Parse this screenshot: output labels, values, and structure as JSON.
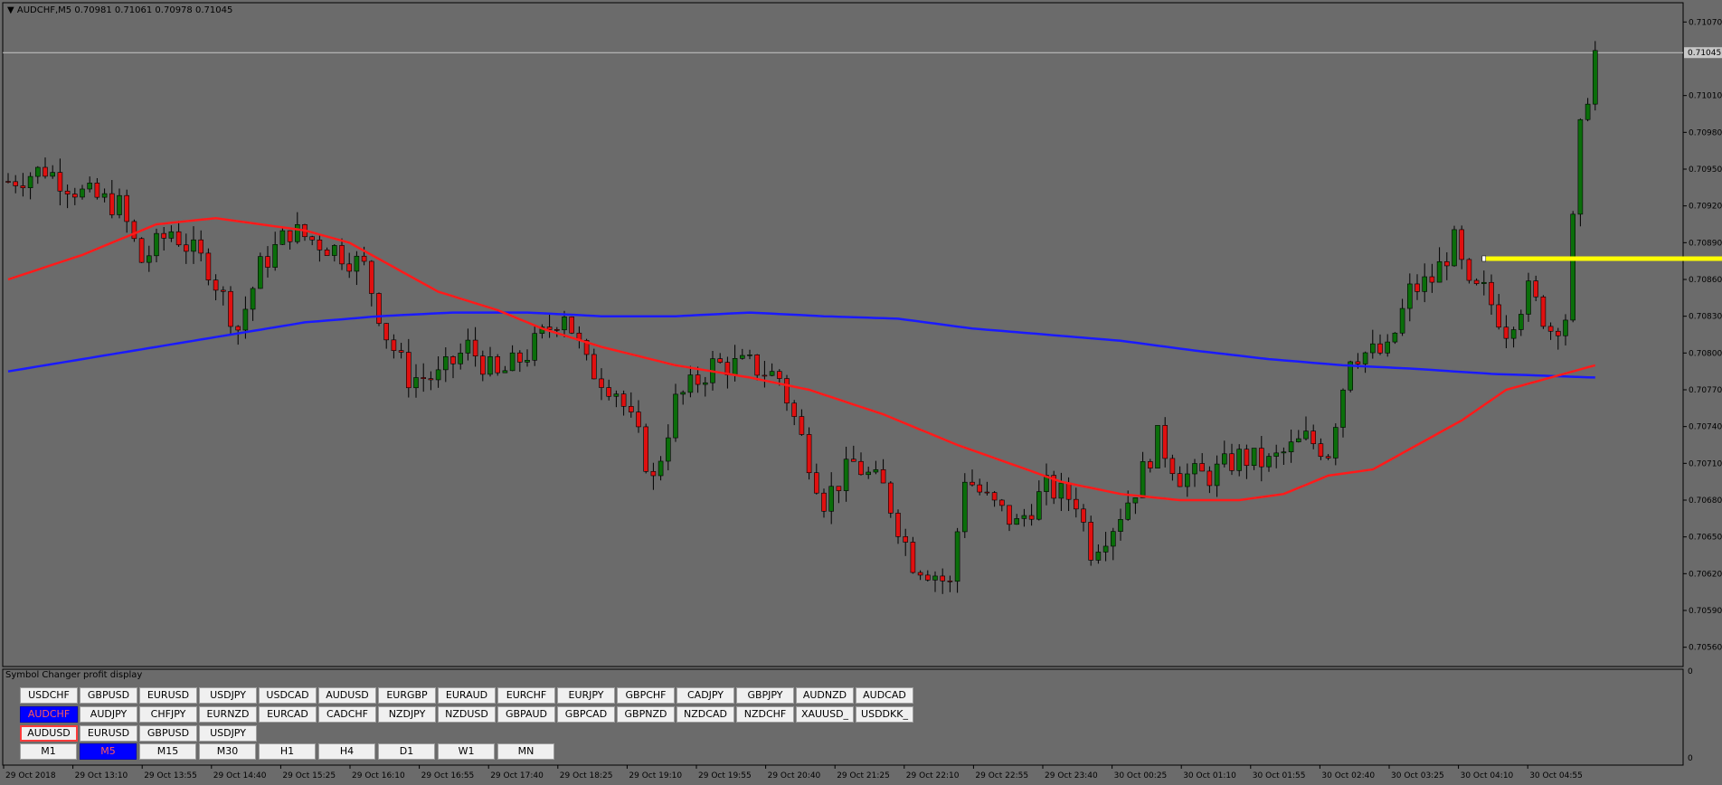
{
  "window": {
    "symbol_title": "AUDCHF,M5",
    "ohlc": "0.70981 0.71061 0.70978 0.71045"
  },
  "colors": {
    "background": "#6b6b6b",
    "bull": "#0a6e0a",
    "bear": "#e01010",
    "ma_fast": "#ff1a1a",
    "ma_slow": "#1a1aff",
    "level": "#ffff00",
    "price_line": "#c8c8c8"
  },
  "chart_data": {
    "type": "candlestick",
    "ylim": [
      0.70545,
      0.71085
    ],
    "x_count": 240,
    "y_ticks": [
      "0.71070",
      "0.71010",
      "0.70980",
      "0.70950",
      "0.70920",
      "0.70890",
      "0.70860",
      "0.70830",
      "0.70800",
      "0.70770",
      "0.70740",
      "0.70710",
      "0.70680",
      "0.70650",
      "0.70620",
      "0.70590",
      "0.70560"
    ],
    "current_price": "0.71045",
    "x_ticks": [
      "29 Oct 2018",
      "29 Oct 13:10",
      "29 Oct 13:55",
      "29 Oct 14:40",
      "29 Oct 15:25",
      "29 Oct 16:10",
      "29 Oct 16:55",
      "29 Oct 17:40",
      "29 Oct 18:25",
      "29 Oct 19:10",
      "29 Oct 19:55",
      "29 Oct 20:40",
      "29 Oct 21:25",
      "29 Oct 22:10",
      "29 Oct 22:55",
      "29 Oct 23:40",
      "30 Oct 00:25",
      "30 Oct 01:10",
      "30 Oct 01:55",
      "30 Oct 02:40",
      "30 Oct 03:25",
      "30 Oct 04:10",
      "30 Oct 04:55"
    ],
    "close_path": [
      [
        0,
        0.7094
      ],
      [
        5,
        0.7095
      ],
      [
        10,
        0.7093
      ],
      [
        15,
        0.7092
      ],
      [
        18,
        0.70875
      ],
      [
        22,
        0.709
      ],
      [
        27,
        0.7087
      ],
      [
        31,
        0.7082
      ],
      [
        34,
        0.7087
      ],
      [
        38,
        0.709
      ],
      [
        44,
        0.70885
      ],
      [
        48,
        0.7087
      ],
      [
        51,
        0.70815
      ],
      [
        54,
        0.7078
      ],
      [
        58,
        0.7078
      ],
      [
        62,
        0.70805
      ],
      [
        66,
        0.7078
      ],
      [
        70,
        0.708
      ],
      [
        75,
        0.70835
      ],
      [
        78,
        0.7079
      ],
      [
        82,
        0.7077
      ],
      [
        85,
        0.7073
      ],
      [
        87,
        0.70695
      ],
      [
        90,
        0.7076
      ],
      [
        95,
        0.7079
      ],
      [
        100,
        0.7079
      ],
      [
        104,
        0.7078
      ],
      [
        107,
        0.7073
      ],
      [
        110,
        0.7068
      ],
      [
        114,
        0.7071
      ],
      [
        118,
        0.7069
      ],
      [
        122,
        0.7063
      ],
      [
        125,
        0.7062
      ],
      [
        127,
        0.7061
      ],
      [
        129,
        0.707
      ],
      [
        132,
        0.7068
      ],
      [
        136,
        0.7066
      ],
      [
        140,
        0.7069
      ],
      [
        144,
        0.7068
      ],
      [
        146,
        0.7064
      ],
      [
        149,
        0.7066
      ],
      [
        152,
        0.7069
      ],
      [
        155,
        0.7073
      ],
      [
        158,
        0.707
      ],
      [
        162,
        0.707
      ],
      [
        166,
        0.70715
      ],
      [
        170,
        0.7071
      ],
      [
        175,
        0.7073
      ],
      [
        178,
        0.7072
      ],
      [
        181,
        0.708
      ],
      [
        186,
        0.708
      ],
      [
        189,
        0.7085
      ],
      [
        192,
        0.7086
      ],
      [
        195,
        0.7089
      ],
      [
        197,
        0.7085
      ],
      [
        199,
        0.7085
      ],
      [
        202,
        0.7082
      ],
      [
        205,
        0.7085
      ],
      [
        208,
        0.7082
      ],
      [
        210,
        0.7083
      ],
      [
        212,
        0.7098
      ],
      [
        214,
        0.71045
      ]
    ],
    "ma_fast": [
      [
        0,
        0.7086
      ],
      [
        10,
        0.7088
      ],
      [
        20,
        0.70905
      ],
      [
        28,
        0.7091
      ],
      [
        34,
        0.70905
      ],
      [
        40,
        0.709
      ],
      [
        46,
        0.7089
      ],
      [
        52,
        0.7087
      ],
      [
        58,
        0.7085
      ],
      [
        66,
        0.70835
      ],
      [
        72,
        0.7082
      ],
      [
        80,
        0.70805
      ],
      [
        90,
        0.7079
      ],
      [
        100,
        0.7078
      ],
      [
        108,
        0.7077
      ],
      [
        118,
        0.7075
      ],
      [
        128,
        0.70725
      ],
      [
        135,
        0.7071
      ],
      [
        142,
        0.70695
      ],
      [
        150,
        0.70685
      ],
      [
        158,
        0.7068
      ],
      [
        166,
        0.7068
      ],
      [
        172,
        0.70685
      ],
      [
        178,
        0.707
      ],
      [
        184,
        0.70705
      ],
      [
        190,
        0.70725
      ],
      [
        196,
        0.70745
      ],
      [
        202,
        0.7077
      ],
      [
        208,
        0.7078
      ],
      [
        214,
        0.7079
      ]
    ],
    "ma_slow": [
      [
        0,
        0.70785
      ],
      [
        10,
        0.70795
      ],
      [
        20,
        0.70805
      ],
      [
        30,
        0.70815
      ],
      [
        40,
        0.70825
      ],
      [
        50,
        0.7083
      ],
      [
        60,
        0.70833
      ],
      [
        70,
        0.70833
      ],
      [
        80,
        0.7083
      ],
      [
        90,
        0.7083
      ],
      [
        100,
        0.70833
      ],
      [
        110,
        0.7083
      ],
      [
        120,
        0.70828
      ],
      [
        130,
        0.7082
      ],
      [
        140,
        0.70815
      ],
      [
        150,
        0.7081
      ],
      [
        160,
        0.70802
      ],
      [
        170,
        0.70795
      ],
      [
        180,
        0.7079
      ],
      [
        190,
        0.70787
      ],
      [
        200,
        0.70783
      ],
      [
        214,
        0.7078
      ]
    ],
    "level_line": {
      "price": 0.70877,
      "x_start": 199,
      "x_end": 234
    }
  },
  "panel": {
    "title": "Symbol Changer profit display",
    "scale_top": "0",
    "scale_bottom": "0",
    "rows": [
      [
        "USDCHF",
        "GBPUSD",
        "EURUSD",
        "USDJPY",
        "USDCAD",
        "AUDUSD",
        "EURGBP",
        "EURAUD",
        "EURCHF",
        "EURJPY",
        "GBPCHF",
        "CADJPY",
        "GBPJPY",
        "AUDNZD",
        "AUDCAD"
      ],
      [
        "AUDCHF",
        "AUDJPY",
        "CHFJPY",
        "EURNZD",
        "EURCAD",
        "CADCHF",
        "NZDJPY",
        "NZDUSD",
        "GBPAUD",
        "GBPCAD",
        "GBPNZD",
        "NZDCAD",
        "NZDCHF",
        "XAUUSD_",
        "USDDKK_"
      ],
      [
        "AUDUSD",
        "EURUSD",
        "GBPUSD",
        "USDJPY"
      ],
      [
        "M1",
        "M5",
        "M15",
        "M30",
        "H1",
        "H4",
        "D1",
        "W1",
        "MN"
      ]
    ],
    "selected_symbol": "AUDCHF",
    "selected_timeframe": "M5"
  }
}
